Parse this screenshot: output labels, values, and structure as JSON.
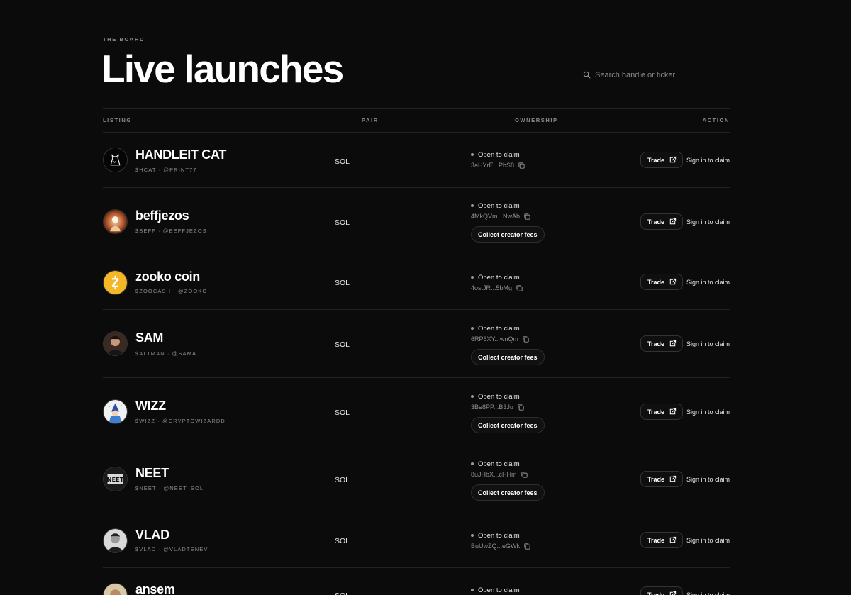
{
  "header": {
    "eyebrow": "THE BOARD",
    "title": "Live launches",
    "search_placeholder": "Search handle or ticker"
  },
  "columns": {
    "listing": "LISTING",
    "pair": "PAIR",
    "ownership": "OWNERSHIP",
    "action": "ACTION"
  },
  "rows": [
    {
      "name": "HANDLEIT CAT",
      "sub": "$HCAT · @PRINT77",
      "pair": "SOL",
      "status": "Open to claim",
      "address": "3aHYrE...PbS8",
      "fees_label": "",
      "trade": "Trade",
      "signin": "Sign in to claim"
    },
    {
      "name": "beffjezos",
      "sub": "$BEFF · @BEFFJEZOS",
      "pair": "SOL",
      "status": "Open to claim",
      "address": "4MkQVm...NwAb",
      "fees_label": "Collect creator fees",
      "trade": "Trade",
      "signin": "Sign in to claim"
    },
    {
      "name": "zooko coin",
      "sub": "$ZOOCASH · @ZOOKO",
      "pair": "SOL",
      "status": "Open to claim",
      "address": "4ostJR...5bMg",
      "fees_label": "",
      "trade": "Trade",
      "signin": "Sign in to claim"
    },
    {
      "name": "SAM",
      "sub": "$ALTMAN · @SAMA",
      "pair": "SOL",
      "status": "Open to claim",
      "address": "6RP6XY...wnQm",
      "fees_label": "Collect creator fees",
      "trade": "Trade",
      "signin": "Sign in to claim"
    },
    {
      "name": "WIZZ",
      "sub": "$WIZZ · @CRYPTOWIZARDD",
      "pair": "SOL",
      "status": "Open to claim",
      "address": "3Be8PP...B3Ju",
      "fees_label": "Collect creator fees",
      "trade": "Trade",
      "signin": "Sign in to claim"
    },
    {
      "name": "NEET",
      "sub": "$NEET · @NEET_SOL",
      "pair": "SOL",
      "status": "Open to claim",
      "address": "8uJHbX...cHHm",
      "fees_label": "Collect creator fees",
      "trade": "Trade",
      "signin": "Sign in to claim"
    },
    {
      "name": "VLAD",
      "sub": "$VLAD · @VLADTENEV",
      "pair": "SOL",
      "status": "Open to claim",
      "address": "BuUwZQ...eGWk",
      "fees_label": "",
      "trade": "Trade",
      "signin": "Sign in to claim"
    },
    {
      "name": "ansem",
      "sub": "",
      "pair": "SOL",
      "status": "Open to claim",
      "address": "",
      "fees_label": "",
      "trade": "Trade",
      "signin": "Sign in to claim"
    }
  ],
  "icons": {
    "search": "search-icon",
    "copy": "copy-icon",
    "external": "external-link-icon"
  },
  "colors": {
    "background": "#0b0b0b",
    "zooko_coin": "#f4b728"
  }
}
